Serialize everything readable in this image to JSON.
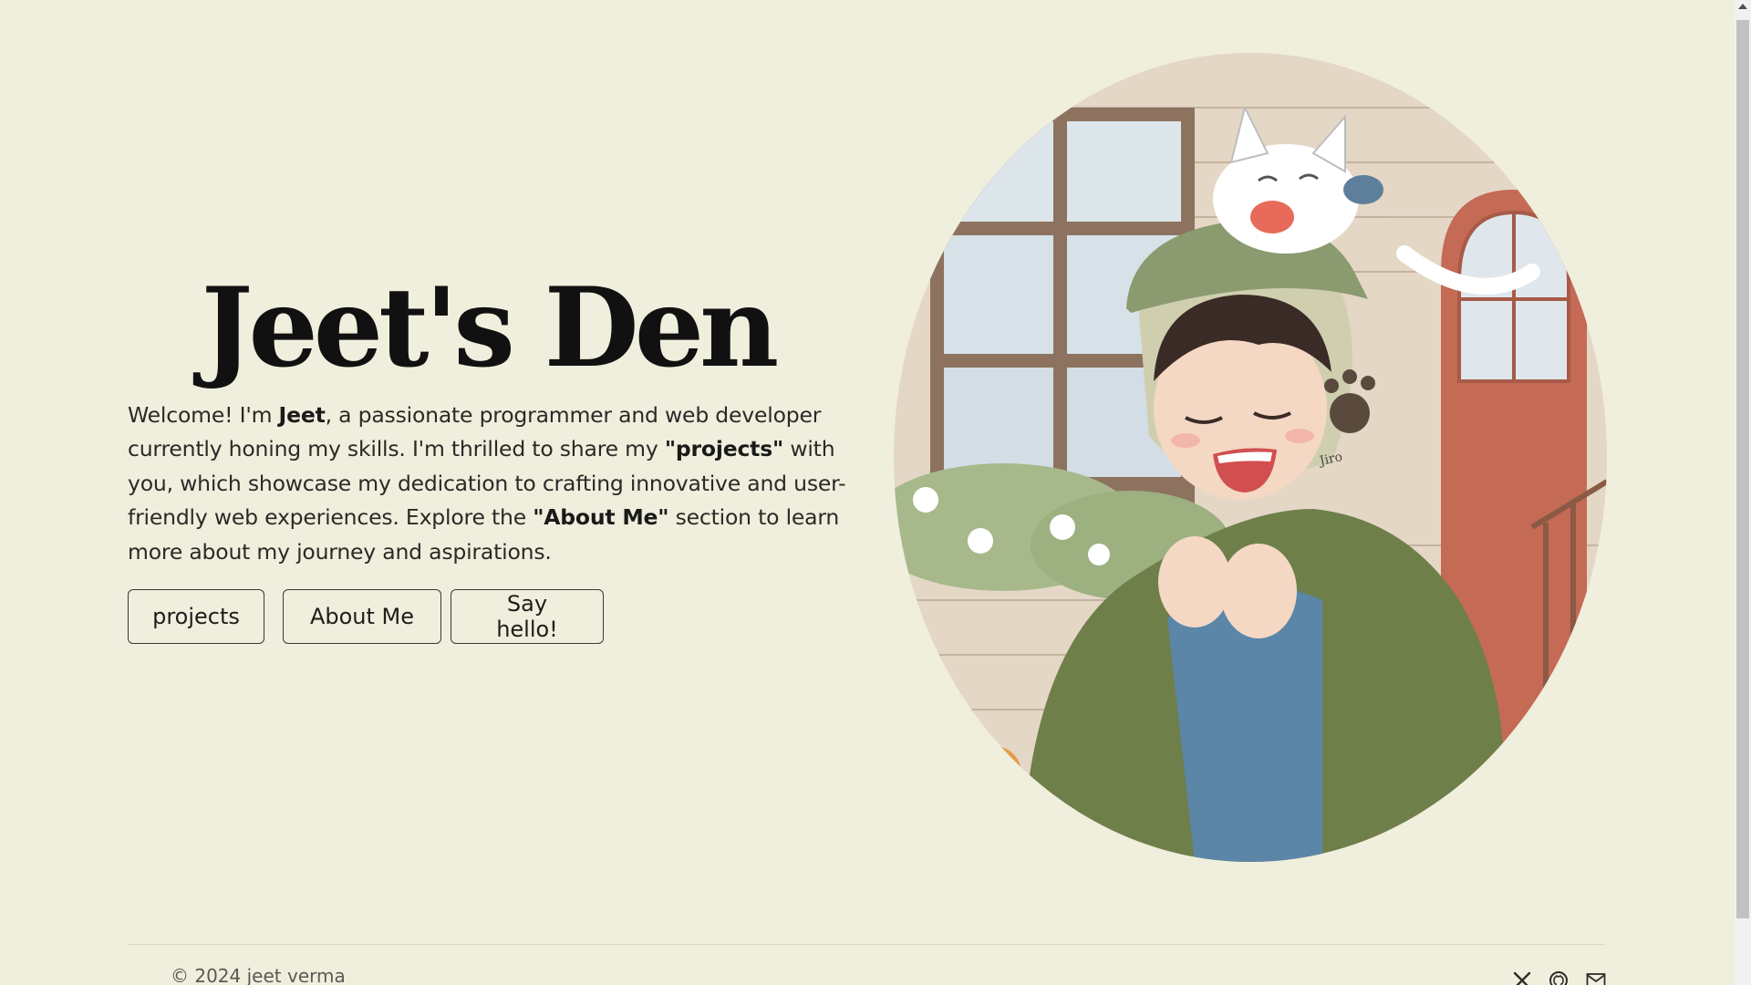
{
  "hero": {
    "title": "Jeet's Den",
    "intro": {
      "p1": "Welcome! I'm ",
      "name": "Jeet",
      "p2": ", a passionate programmer and web developer currently honing my skills. I'm thrilled to share my ",
      "projects_ref": "\"projects\"",
      "p3": " with you, which showcase my dedication to crafting innovative and user-friendly web experiences. Explore the ",
      "about_ref": "\"About Me\"",
      "p4": " section to learn more about my journey and aspirations."
    },
    "buttons": {
      "projects": "projects",
      "about": "About Me",
      "hello": "Say hello!"
    }
  },
  "portrait": {
    "signature": "Jiro"
  },
  "footer": {
    "copyright": "© 2024 jeet verma",
    "icons": [
      "x-icon",
      "github-icon",
      "mail-icon"
    ]
  },
  "colors": {
    "background": "#f0eedd",
    "text": "#1d1d1b",
    "button_border": "#3a3a36",
    "coat_green": "#6e7f4a",
    "sweater_blue": "#5b86a8",
    "door_red": "#c46a55"
  }
}
